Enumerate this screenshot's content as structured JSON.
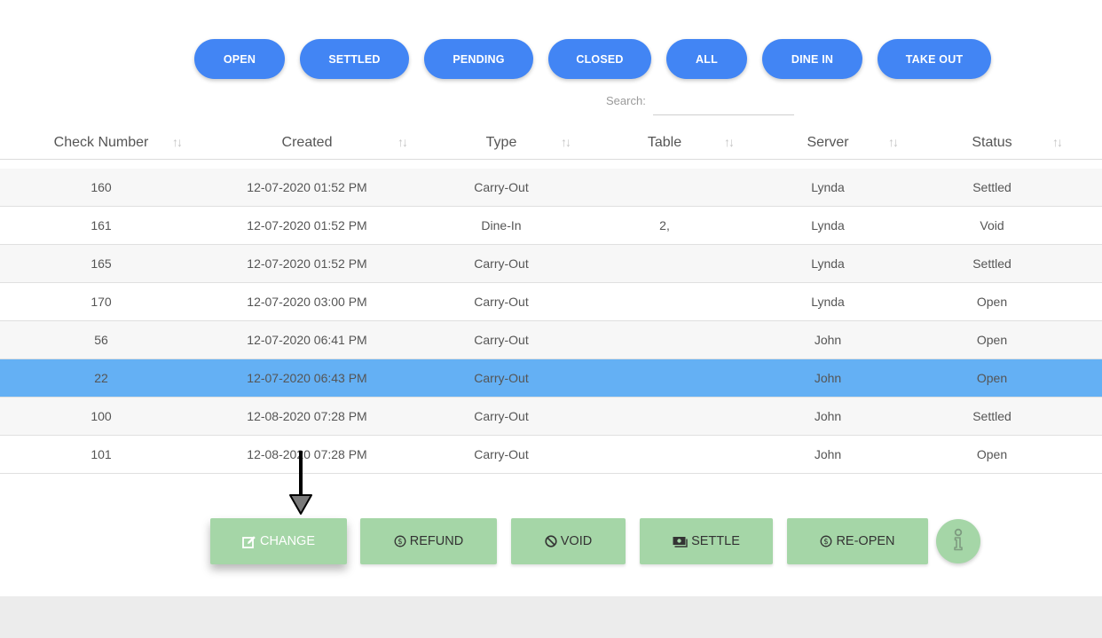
{
  "filters": [
    "OPEN",
    "SETTLED",
    "PENDING",
    "CLOSED",
    "ALL",
    "DINE IN",
    "TAKE OUT"
  ],
  "search": {
    "label": "Search:",
    "value": ""
  },
  "columns": [
    "Check Number",
    "Created",
    "Type",
    "Table",
    "Server",
    "Status"
  ],
  "rows": [
    {
      "check": "160",
      "created": "12-07-2020 01:52 PM",
      "type": "Carry-Out",
      "table": "",
      "server": "Lynda",
      "status": "Settled"
    },
    {
      "check": "161",
      "created": "12-07-2020 01:52 PM",
      "type": "Dine-In",
      "table": "2,",
      "server": "Lynda",
      "status": "Void"
    },
    {
      "check": "165",
      "created": "12-07-2020 01:52 PM",
      "type": "Carry-Out",
      "table": "",
      "server": "Lynda",
      "status": "Settled"
    },
    {
      "check": "170",
      "created": "12-07-2020 03:00 PM",
      "type": "Carry-Out",
      "table": "",
      "server": "Lynda",
      "status": "Open"
    },
    {
      "check": "56",
      "created": "12-07-2020 06:41 PM",
      "type": "Carry-Out",
      "table": "",
      "server": "John",
      "status": "Open"
    },
    {
      "check": "22",
      "created": "12-07-2020 06:43 PM",
      "type": "Carry-Out",
      "table": "",
      "server": "John",
      "status": "Open",
      "selected": true
    },
    {
      "check": "100",
      "created": "12-08-2020 07:28 PM",
      "type": "Carry-Out",
      "table": "",
      "server": "John",
      "status": "Settled"
    },
    {
      "check": "101",
      "created": "12-08-2020 07:28 PM",
      "type": "Carry-Out",
      "table": "",
      "server": "John",
      "status": "Open"
    }
  ],
  "actions": [
    {
      "label": "CHANGE",
      "icon": "edit-icon"
    },
    {
      "label": "REFUND",
      "icon": "dollar-circle-icon"
    },
    {
      "label": "VOID",
      "icon": "block-icon"
    },
    {
      "label": "SETTLE",
      "icon": "cash-icon"
    },
    {
      "label": "RE-OPEN",
      "icon": "dollar-circle-icon"
    }
  ],
  "info_button": {
    "icon": "info-icon"
  },
  "colors": {
    "filter_pill": "#4285f4",
    "action_button": "#a5d6a7",
    "selected_row": "#64b0f4",
    "striped_row": "#f7f7f7",
    "footer": "#ececec"
  }
}
